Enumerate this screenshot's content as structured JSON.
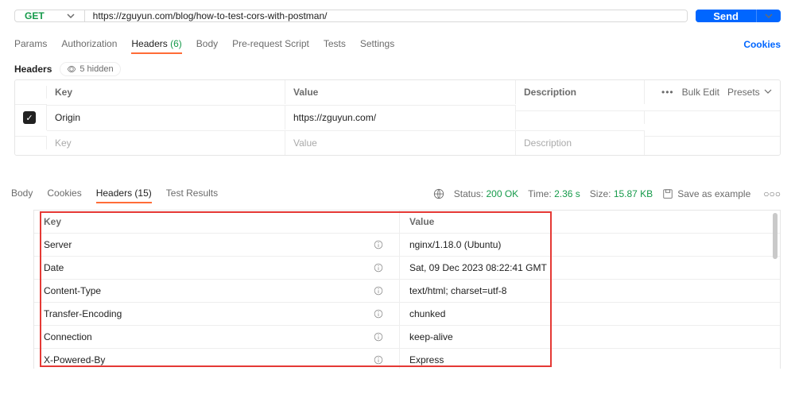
{
  "request": {
    "method": "GET",
    "url": "https://zguyun.com/blog/how-to-test-cors-with-postman/",
    "send_label": "Send"
  },
  "tabs": {
    "items": [
      {
        "label": "Params"
      },
      {
        "label": "Authorization"
      },
      {
        "label": "Headers",
        "count": "(6)",
        "active": true
      },
      {
        "label": "Body"
      },
      {
        "label": "Pre-request Script"
      },
      {
        "label": "Tests"
      },
      {
        "label": "Settings"
      }
    ],
    "cookies_link": "Cookies"
  },
  "headers_section": {
    "title": "Headers",
    "hidden": "5 hidden",
    "columns": {
      "key": "Key",
      "value": "Value",
      "description": "Description"
    },
    "actions": {
      "bulk": "Bulk Edit",
      "presets": "Presets"
    },
    "placeholders": {
      "key": "Key",
      "value": "Value",
      "description": "Description"
    },
    "rows": [
      {
        "checked": true,
        "key": "Origin",
        "value": "https://zguyun.com/",
        "description": ""
      }
    ]
  },
  "response": {
    "tabs": [
      {
        "label": "Body"
      },
      {
        "label": "Cookies"
      },
      {
        "label": "Headers",
        "count": "(15)",
        "active": true
      },
      {
        "label": "Test Results"
      }
    ],
    "status_label": "Status:",
    "status_value": "200 OK",
    "time_label": "Time:",
    "time_value": "2.36 s",
    "size_label": "Size:",
    "size_value": "15.87 KB",
    "save_example": "Save as example",
    "columns": {
      "key": "Key",
      "value": "Value"
    },
    "headers": [
      {
        "key": "Server",
        "value": "nginx/1.18.0 (Ubuntu)"
      },
      {
        "key": "Date",
        "value": "Sat, 09 Dec 2023 08:22:41 GMT"
      },
      {
        "key": "Content-Type",
        "value": "text/html; charset=utf-8"
      },
      {
        "key": "Transfer-Encoding",
        "value": "chunked"
      },
      {
        "key": "Connection",
        "value": "keep-alive"
      },
      {
        "key": "X-Powered-By",
        "value": "Express"
      }
    ]
  }
}
